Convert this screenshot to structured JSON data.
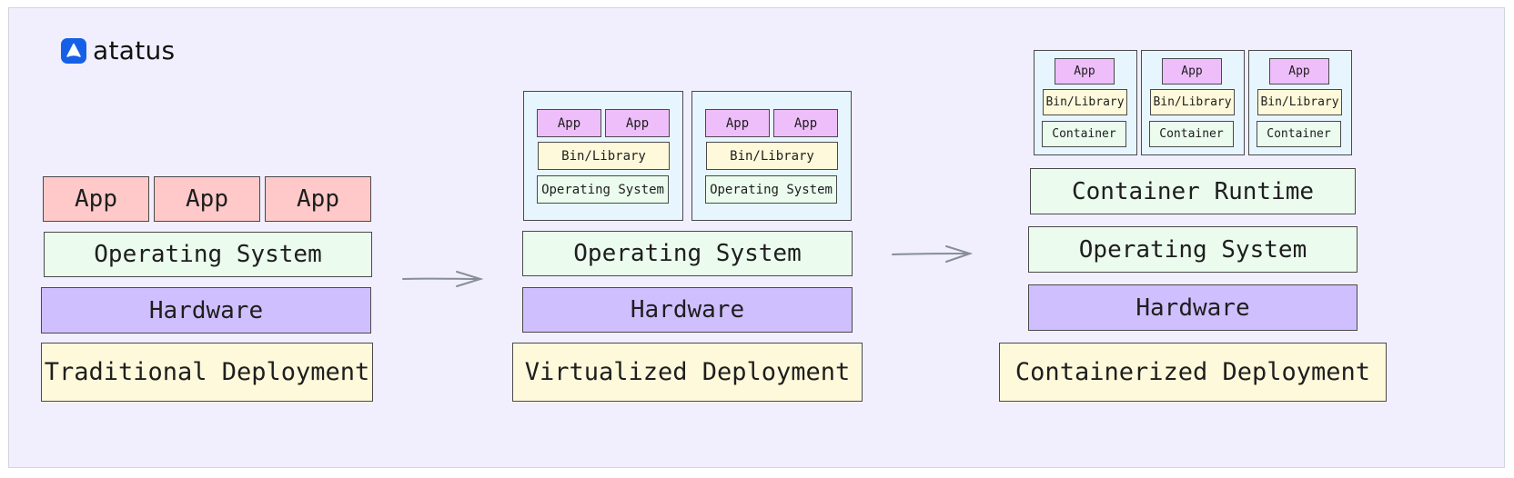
{
  "brand": {
    "name": "atatus",
    "icon": "atatus-logo-icon",
    "color": "#1660e8"
  },
  "colors": {
    "background": "#f1effd",
    "app_traditional": "#ffc9c9",
    "operating_system": "#ebfbee",
    "hardware": "#d0bfff",
    "deployment_label": "#fff9db",
    "app_nested": "#eebefa",
    "vm_container_box": "#e7f5ff",
    "arrow": "#868e96"
  },
  "traditional": {
    "apps": [
      "App",
      "App",
      "App"
    ],
    "os": "Operating System",
    "hardware": "Hardware",
    "label": "Traditional Deployment"
  },
  "virtualized": {
    "vms": [
      {
        "apps": [
          "App",
          "App"
        ],
        "bin": "Bin/Library",
        "os": "Operating System"
      },
      {
        "apps": [
          "App",
          "App"
        ],
        "bin": "Bin/Library",
        "os": "Operating System"
      }
    ],
    "os": "Operating System",
    "hardware": "Hardware",
    "label": "Virtualized Deployment"
  },
  "containerized": {
    "containers": [
      {
        "app": "App",
        "bin": "Bin/Library",
        "container": "Container"
      },
      {
        "app": "App",
        "bin": "Bin/Library",
        "container": "Container"
      },
      {
        "app": "App",
        "bin": "Bin/Library",
        "container": "Container"
      }
    ],
    "runtime": "Container Runtime",
    "os": "Operating System",
    "hardware": "Hardware",
    "label": "Containerized Deployment"
  },
  "arrows": [
    {
      "from": "traditional",
      "to": "virtualized"
    },
    {
      "from": "virtualized",
      "to": "containerized"
    }
  ]
}
